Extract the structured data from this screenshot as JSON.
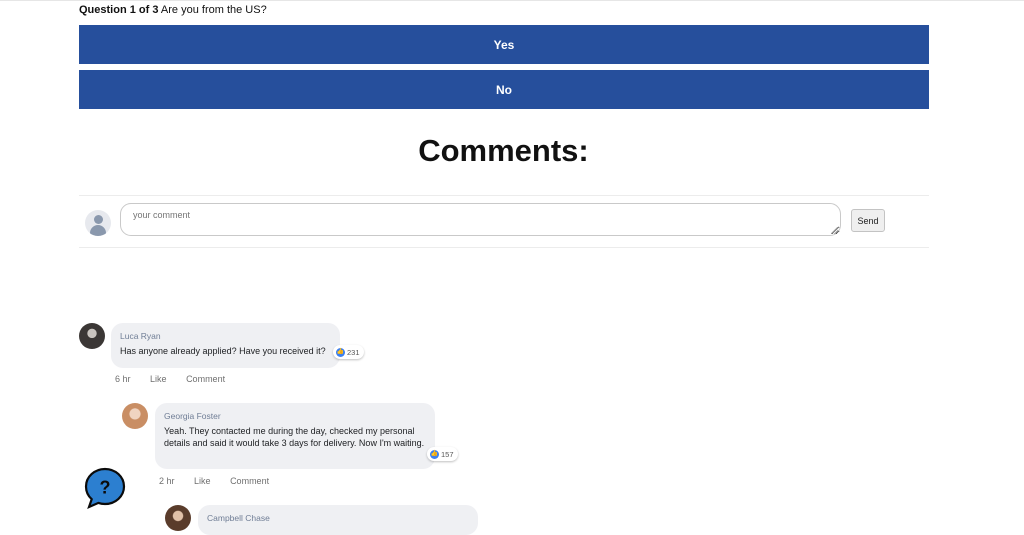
{
  "question": {
    "counter": "Question 1 of 3",
    "text": "Are you from the US?",
    "answers": [
      "Yes",
      "No"
    ]
  },
  "comments_title": "Comments:",
  "comment_form": {
    "placeholder": "your comment",
    "send_label": "Send"
  },
  "comments": [
    {
      "author": "Luca Ryan",
      "text": "Has anyone already applied? Have you received it?",
      "likes": "231",
      "time": "6 hr",
      "like_label": "Like",
      "comment_label": "Comment"
    },
    {
      "author": "Georgia Foster",
      "text": "Yeah. They contacted me during the day, checked my personal details and said it would take 3 days for delivery. Now I'm waiting.",
      "likes": "157",
      "time": "2 hr",
      "like_label": "Like",
      "comment_label": "Comment"
    },
    {
      "author": "Campbell Chase"
    }
  ],
  "colors": {
    "answer_button": "#264f9c",
    "bubble": "#eff0f3",
    "author_name": "#6f7d95",
    "like_icon": "#3b7ff0"
  },
  "icons": [
    "user-placeholder-icon",
    "thumbs-up-icon",
    "help-question-icon"
  ]
}
